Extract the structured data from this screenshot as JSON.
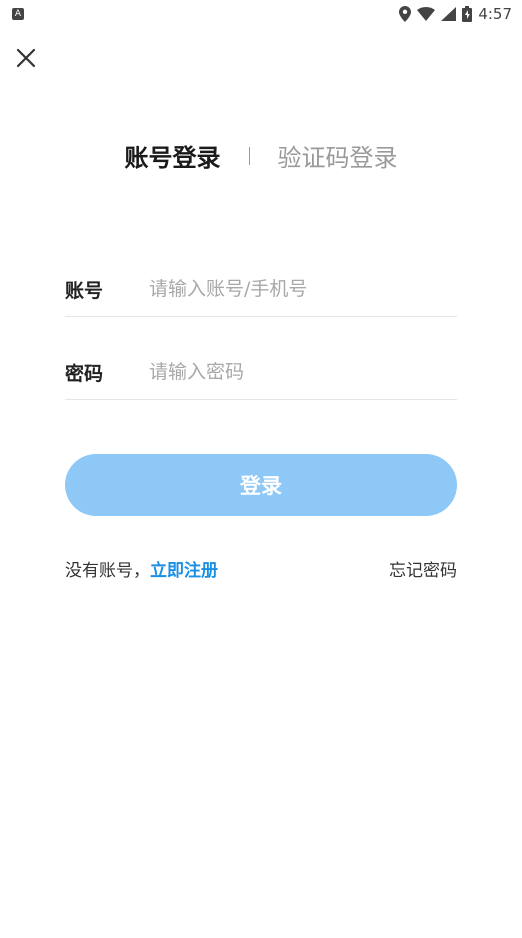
{
  "status_bar": {
    "notification_badge": "A",
    "time": "4:57",
    "icons": [
      "location-icon",
      "wifi-icon",
      "signal-icon",
      "battery-icon"
    ]
  },
  "header": {
    "close_icon": "close-icon"
  },
  "tabs": {
    "account_login": "账号登录",
    "divider": "|",
    "code_login": "验证码登录"
  },
  "form": {
    "account_label": "账号",
    "account_placeholder": "请输入账号/手机号",
    "account_value": "",
    "password_label": "密码",
    "password_placeholder": "请输入密码",
    "password_value": ""
  },
  "login_button": {
    "label": "登录",
    "color": "#8ec8f7"
  },
  "footer": {
    "no_account_text": "没有账号，",
    "register_link": "立即注册",
    "forgot_password": "忘记密码",
    "link_color": "#1a8fe3"
  }
}
